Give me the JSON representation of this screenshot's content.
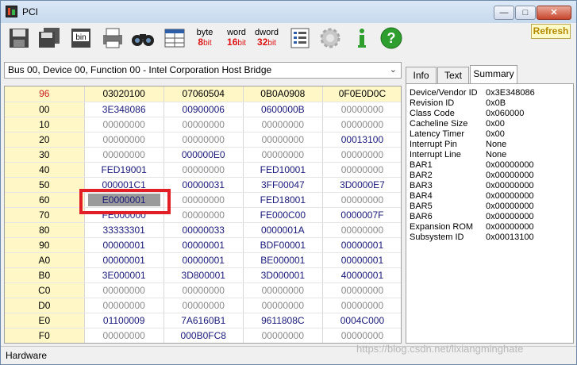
{
  "window": {
    "title": "PCI"
  },
  "toolbar": {
    "byte": {
      "top": "byte",
      "num": "8",
      "unit": "bit"
    },
    "word": {
      "top": "word",
      "num": "16",
      "unit": "bit"
    },
    "dword": {
      "top": "dword",
      "num": "32",
      "unit": "bit"
    },
    "refresh_label": "Refresh"
  },
  "device_selector": {
    "value": "Bus 00, Device 00, Function 00 - Intel Corporation Host Bridge"
  },
  "grid": {
    "header": [
      "96",
      "03020100",
      "07060504",
      "0B0A0908",
      "0F0E0D0C"
    ],
    "rows": [
      {
        "offset": "00",
        "cells": [
          "3E348086",
          "00900006",
          "0600000B",
          "00000000"
        ]
      },
      {
        "offset": "10",
        "cells": [
          "00000000",
          "00000000",
          "00000000",
          "00000000"
        ]
      },
      {
        "offset": "20",
        "cells": [
          "00000000",
          "00000000",
          "00000000",
          "00013100"
        ]
      },
      {
        "offset": "30",
        "cells": [
          "00000000",
          "000000E0",
          "00000000",
          "00000000"
        ]
      },
      {
        "offset": "40",
        "cells": [
          "FED19001",
          "00000000",
          "FED10001",
          "00000000"
        ]
      },
      {
        "offset": "50",
        "cells": [
          "000001C1",
          "00000031",
          "3FF00047",
          "3D0000E7"
        ]
      },
      {
        "offset": "60",
        "cells": [
          "E0000001",
          "00000000",
          "FED18001",
          "00000000"
        ]
      },
      {
        "offset": "70",
        "cells": [
          "FE000000",
          "00000000",
          "FE000C00",
          "0000007F"
        ]
      },
      {
        "offset": "80",
        "cells": [
          "33333301",
          "00000033",
          "0000001A",
          "00000000"
        ]
      },
      {
        "offset": "90",
        "cells": [
          "00000001",
          "00000001",
          "BDF00001",
          "00000001"
        ]
      },
      {
        "offset": "A0",
        "cells": [
          "00000001",
          "00000001",
          "BE000001",
          "00000001"
        ]
      },
      {
        "offset": "B0",
        "cells": [
          "3E000001",
          "3D800001",
          "3D000001",
          "40000001"
        ]
      },
      {
        "offset": "C0",
        "cells": [
          "00000000",
          "00000000",
          "00000000",
          "00000000"
        ]
      },
      {
        "offset": "D0",
        "cells": [
          "00000000",
          "00000000",
          "00000000",
          "00000000"
        ]
      },
      {
        "offset": "E0",
        "cells": [
          "01100009",
          "7A6160B1",
          "9611808C",
          "0004C000"
        ]
      },
      {
        "offset": "F0",
        "cells": [
          "00000000",
          "000B0FC8",
          "00000000",
          "00000000"
        ]
      }
    ]
  },
  "tabs": [
    "Info",
    "Text",
    "Summary"
  ],
  "summary": [
    {
      "key": "Device/Vendor ID",
      "value": "0x3E348086"
    },
    {
      "key": "Revision ID",
      "value": "0x0B"
    },
    {
      "key": "Class Code",
      "value": "0x060000"
    },
    {
      "key": "Cacheline Size",
      "value": "0x00"
    },
    {
      "key": "Latency Timer",
      "value": "0x00"
    },
    {
      "key": "Interrupt Pin",
      "value": "None"
    },
    {
      "key": "Interrupt Line",
      "value": "None"
    },
    {
      "key": "BAR1",
      "value": "0x00000000"
    },
    {
      "key": "BAR2",
      "value": "0x00000000"
    },
    {
      "key": "BAR3",
      "value": "0x00000000"
    },
    {
      "key": "BAR4",
      "value": "0x00000000"
    },
    {
      "key": "BAR5",
      "value": "0x00000000"
    },
    {
      "key": "BAR6",
      "value": "0x00000000"
    },
    {
      "key": "Expansion ROM",
      "value": "0x00000000"
    },
    {
      "key": "Subsystem ID",
      "value": "0x00013100"
    }
  ],
  "statusbar": {
    "text": "Hardware"
  },
  "watermark": "https://blog.csdn.net/lixiangminghate",
  "colors": {
    "highlight": "#e21f26",
    "value_text": "#1a1a7a",
    "header_bg": "#fff7c6"
  }
}
